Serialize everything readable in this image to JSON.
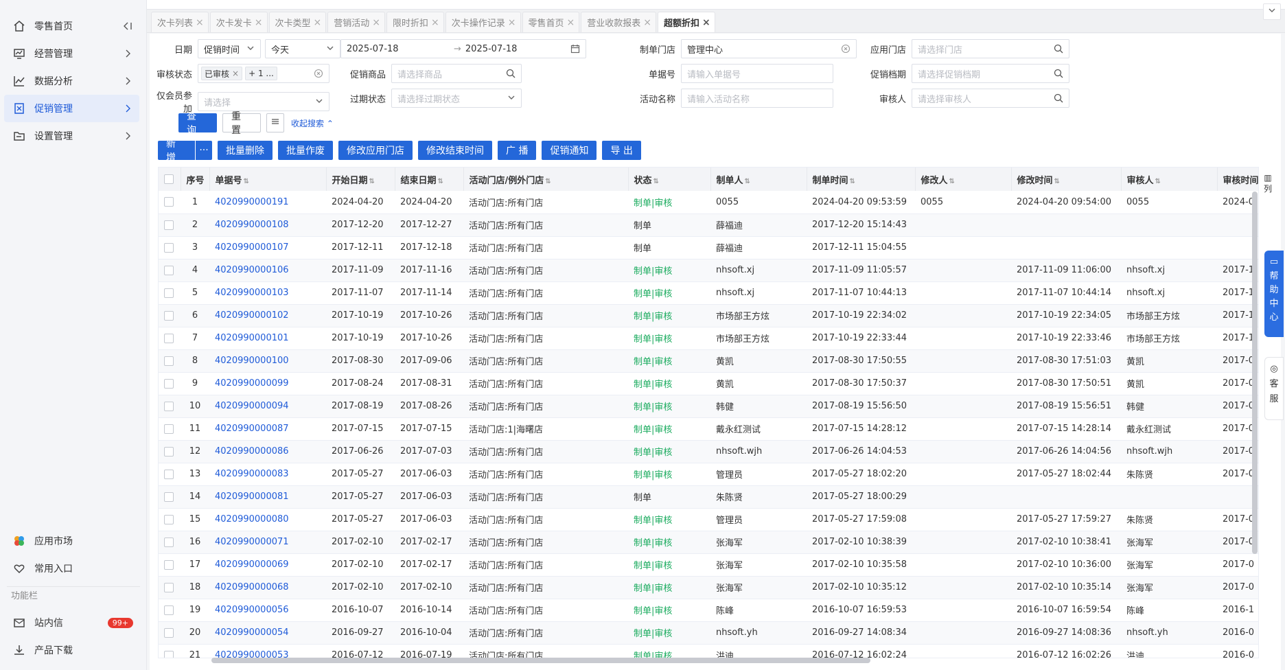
{
  "sidebar": {
    "items": [
      {
        "label": "零售首页",
        "icon": "home-icon"
      },
      {
        "label": "经营管理",
        "icon": "chart-board-icon"
      },
      {
        "label": "数据分析",
        "icon": "line-chart-icon"
      },
      {
        "label": "促销管理",
        "icon": "promotion-icon"
      },
      {
        "label": "设置管理",
        "icon": "folder-icon"
      }
    ],
    "bottom": {
      "app_market": "应用市场",
      "favorites": "常用入口",
      "section_title": "功能栏",
      "messages": "站内信",
      "messages_badge": "99+",
      "downloads": "产品下载"
    }
  },
  "tabs": [
    {
      "label": "次卡列表"
    },
    {
      "label": "次卡发卡"
    },
    {
      "label": "次卡类型"
    },
    {
      "label": "营销活动"
    },
    {
      "label": "限时折扣"
    },
    {
      "label": "次卡操作记录"
    },
    {
      "label": "零售首页"
    },
    {
      "label": "营业收款报表"
    },
    {
      "label": "超额折扣",
      "active": true
    }
  ],
  "filters": {
    "date_label": "日期",
    "date_type": "促销时间",
    "date_preset": "今天",
    "date_start": "2025-07-18",
    "date_end": "2025-07-18",
    "store_label": "制单门店",
    "store_value": "管理中心",
    "apply_store_label": "应用门店",
    "apply_store_ph": "请选择门店",
    "audit_label": "审核状态",
    "audit_tag1": "已审核",
    "audit_tag2": "+ 1 ...",
    "product_label": "促销商品",
    "product_ph": "请选择商品",
    "doc_label": "单据号",
    "doc_ph": "请输入单据号",
    "tier_label": "促销档期",
    "tier_ph": "请选择促销档期",
    "member_label": "仅会员参加",
    "member_ph": "请选择",
    "expire_label": "过期状态",
    "expire_ph": "请选择过期状态",
    "activity_label": "活动名称",
    "activity_ph": "请输入活动名称",
    "auditor_label": "审核人",
    "auditor_ph": "请选择审核人",
    "query": "查 询",
    "reset": "重 置",
    "collapse": "收起搜索"
  },
  "toolbar": {
    "add": "新 增",
    "more": "···",
    "batch_delete": "批量删除",
    "batch_void": "批量作废",
    "edit_store": "修改应用门店",
    "edit_end": "修改结束时间",
    "broadcast": "广 播",
    "notify": "促销通知",
    "export": "导 出"
  },
  "table": {
    "headers": [
      "序号",
      "单据号",
      "开始日期",
      "结束日期",
      "活动门店/例外门店",
      "状态",
      "制单人",
      "制单时间",
      "修改人",
      "修改时间",
      "审核人",
      "审核时间"
    ],
    "column_toggle": "列",
    "rows": [
      [
        "1",
        "4020990000191",
        "2024-04-20",
        "2024-04-20",
        "活动门店:所有门店",
        "制单|审核",
        "0055",
        "2024-04-20 09:53:59",
        "0055",
        "2024-04-20 09:54:00",
        "0055",
        "2024-0"
      ],
      [
        "2",
        "4020990000108",
        "2017-12-20",
        "2017-12-27",
        "活动门店:所有门店",
        "制单",
        "薛福迪",
        "2017-12-20 15:14:43",
        "",
        "",
        "",
        ""
      ],
      [
        "3",
        "4020990000107",
        "2017-12-11",
        "2017-12-18",
        "活动门店:所有门店",
        "制单",
        "薛福迪",
        "2017-12-11 15:04:55",
        "",
        "",
        "",
        ""
      ],
      [
        "4",
        "4020990000106",
        "2017-11-09",
        "2017-11-16",
        "活动门店:所有门店",
        "制单|审核",
        "nhsoft.xj",
        "2017-11-09 11:05:57",
        "",
        "2017-11-09 11:06:00",
        "nhsoft.xj",
        "2017-1"
      ],
      [
        "5",
        "4020990000103",
        "2017-11-07",
        "2017-11-14",
        "活动门店:所有门店",
        "制单|审核",
        "nhsoft.xj",
        "2017-11-07 10:44:13",
        "",
        "2017-11-07 10:44:14",
        "nhsoft.xj",
        "2017-1"
      ],
      [
        "6",
        "4020990000102",
        "2017-10-19",
        "2017-10-26",
        "活动门店:所有门店",
        "制单|审核",
        "市场部王方炫",
        "2017-10-19 22:34:02",
        "",
        "2017-10-19 22:34:05",
        "市场部王方炫",
        "2017-1"
      ],
      [
        "7",
        "4020990000101",
        "2017-10-19",
        "2017-10-26",
        "活动门店:所有门店",
        "制单|审核",
        "市场部王方炫",
        "2017-10-19 22:33:44",
        "",
        "2017-10-19 22:33:46",
        "市场部王方炫",
        "2017-1"
      ],
      [
        "8",
        "4020990000100",
        "2017-08-30",
        "2017-09-06",
        "活动门店:所有门店",
        "制单|审核",
        "黄凯",
        "2017-08-30 17:50:55",
        "",
        "2017-08-30 17:51:03",
        "黄凯",
        "2017-0"
      ],
      [
        "9",
        "4020990000099",
        "2017-08-24",
        "2017-08-31",
        "活动门店:所有门店",
        "制单|审核",
        "黄凯",
        "2017-08-30 17:50:37",
        "",
        "2017-08-30 17:50:51",
        "黄凯",
        "2017-0"
      ],
      [
        "10",
        "4020990000094",
        "2017-08-19",
        "2017-08-26",
        "活动门店:所有门店",
        "制单|审核",
        "韩健",
        "2017-08-19 15:56:50",
        "",
        "2017-08-19 15:56:51",
        "韩健",
        "2017-0"
      ],
      [
        "11",
        "4020990000087",
        "2017-07-15",
        "2017-07-15",
        "活动门店:1|海曙店",
        "制单|审核",
        "戴永红测试",
        "2017-07-15 14:28:12",
        "",
        "2017-07-15 14:28:14",
        "戴永红测试",
        "2017-0"
      ],
      [
        "12",
        "4020990000086",
        "2017-06-26",
        "2017-07-03",
        "活动门店:所有门店",
        "制单|审核",
        "nhsoft.wjh",
        "2017-06-26 14:04:53",
        "",
        "2017-06-26 14:04:56",
        "nhsoft.wjh",
        "2017-0"
      ],
      [
        "13",
        "4020990000083",
        "2017-05-27",
        "2017-06-03",
        "活动门店:所有门店",
        "制单|审核",
        "管理员",
        "2017-05-27 18:02:20",
        "",
        "2017-05-27 18:02:44",
        "朱陈贤",
        "2017-0"
      ],
      [
        "14",
        "4020990000081",
        "2017-05-27",
        "2017-06-03",
        "活动门店:所有门店",
        "制单",
        "朱陈贤",
        "2017-05-27 18:00:29",
        "",
        "",
        "",
        ""
      ],
      [
        "15",
        "4020990000080",
        "2017-05-27",
        "2017-06-03",
        "活动门店:所有门店",
        "制单|审核",
        "管理员",
        "2017-05-27 17:59:08",
        "",
        "2017-05-27 17:59:27",
        "朱陈贤",
        "2017-0"
      ],
      [
        "16",
        "4020990000071",
        "2017-02-10",
        "2017-02-17",
        "活动门店:所有门店",
        "制单|审核",
        "张海军",
        "2017-02-10 10:38:39",
        "",
        "2017-02-10 10:38:41",
        "张海军",
        "2017-0"
      ],
      [
        "17",
        "4020990000069",
        "2017-02-10",
        "2017-02-17",
        "活动门店:所有门店",
        "制单|审核",
        "张海军",
        "2017-02-10 10:35:58",
        "",
        "2017-02-10 10:36:00",
        "张海军",
        "2017-0"
      ],
      [
        "18",
        "4020990000068",
        "2017-02-10",
        "2017-02-10",
        "活动门店:所有门店",
        "制单|审核",
        "张海军",
        "2017-02-10 10:35:12",
        "",
        "2017-02-10 10:35:14",
        "张海军",
        "2017-0"
      ],
      [
        "19",
        "4020990000056",
        "2016-10-07",
        "2016-10-14",
        "活动门店:所有门店",
        "制单|审核",
        "陈峰",
        "2016-10-07 16:59:53",
        "",
        "2016-10-07 16:59:54",
        "陈峰",
        "2016-1"
      ],
      [
        "20",
        "4020990000054",
        "2016-09-27",
        "2016-10-04",
        "活动门店:所有门店",
        "制单|审核",
        "nhsoft.yh",
        "2016-09-27 14:08:34",
        "",
        "2016-09-27 14:08:36",
        "nhsoft.yh",
        "2016-0"
      ],
      [
        "21",
        "4020990000053",
        "2016-07-12",
        "2016-07-19",
        "活动门店:所有门店",
        "制单|审核",
        "洪迪",
        "2016-07-12 16:02:24",
        "",
        "2016-07-12 16:02:26",
        "洪迪",
        "2016-0"
      ]
    ]
  },
  "floating": {
    "help": "帮助中心",
    "service": "客服"
  },
  "colors": {
    "primary": "#2467d9",
    "status_ok": "#1aab5e",
    "link": "#1f5bd8"
  }
}
